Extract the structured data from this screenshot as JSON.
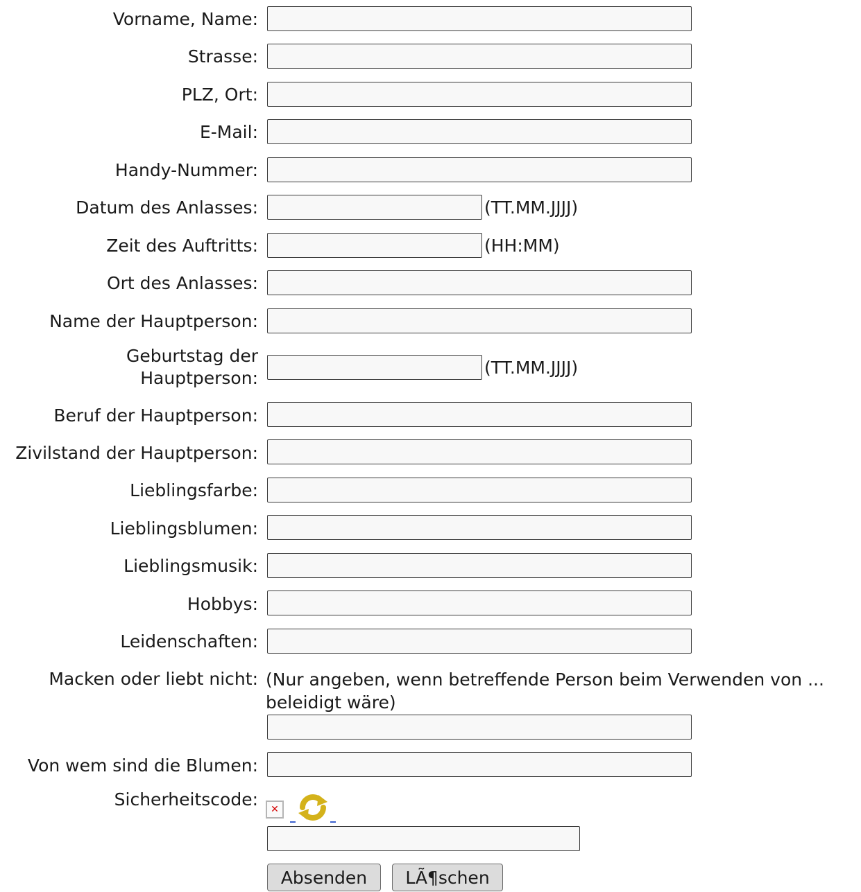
{
  "form": {
    "fields": {
      "name": {
        "label": "Vorname, Name:",
        "value": ""
      },
      "street": {
        "label": "Strasse:",
        "value": ""
      },
      "zip_city": {
        "label": "PLZ, Ort:",
        "value": ""
      },
      "email": {
        "label": "E-Mail:",
        "value": ""
      },
      "mobile": {
        "label": "Handy-Nummer:",
        "value": ""
      },
      "event_date": {
        "label": "Datum des Anlasses:",
        "value": "",
        "hint": "(TT.MM.JJJJ)"
      },
      "performance_time": {
        "label": "Zeit des Auftritts:",
        "value": "",
        "hint": "(HH:MM)"
      },
      "event_location": {
        "label": "Ort des Anlasses:",
        "value": ""
      },
      "main_person_name": {
        "label": "Name der Hauptperson:",
        "value": ""
      },
      "main_person_birthday": {
        "label": "Geburtstag der Hauptperson:",
        "value": "",
        "hint": "(TT.MM.JJJJ)"
      },
      "main_person_job": {
        "label": "Beruf der Hauptperson:",
        "value": ""
      },
      "main_person_civil_status": {
        "label": "Zivilstand der Hauptperson:",
        "value": ""
      },
      "favorite_color": {
        "label": "Lieblingsfarbe:",
        "value": ""
      },
      "favorite_flowers": {
        "label": "Lieblingsblumen:",
        "value": ""
      },
      "favorite_music": {
        "label": "Lieblingsmusik:",
        "value": ""
      },
      "hobbies": {
        "label": "Hobbys:",
        "value": ""
      },
      "passions": {
        "label": "Leidenschaften:",
        "value": ""
      },
      "dislikes": {
        "label": "Macken oder liebt nicht:",
        "value": "",
        "note": "(Nur angeben, wenn betreffende Person beim Verwenden von ... beleidigt wäre)"
      },
      "flowers_from": {
        "label": "Von wem sind die Blumen:",
        "value": ""
      },
      "security_code": {
        "label": "Sicherheitscode:",
        "value": ""
      }
    },
    "captcha": {
      "image_icon": "broken-image-icon",
      "refresh_icon": "refresh-icon"
    },
    "buttons": {
      "submit": "Absenden",
      "reset": "LÃ¶schen"
    }
  },
  "colors": {
    "input_bg": "#f8f8f8",
    "button_bg": "#dcdcdc",
    "refresh_icon": "#d4b21a",
    "link": "#3a5fcd"
  }
}
